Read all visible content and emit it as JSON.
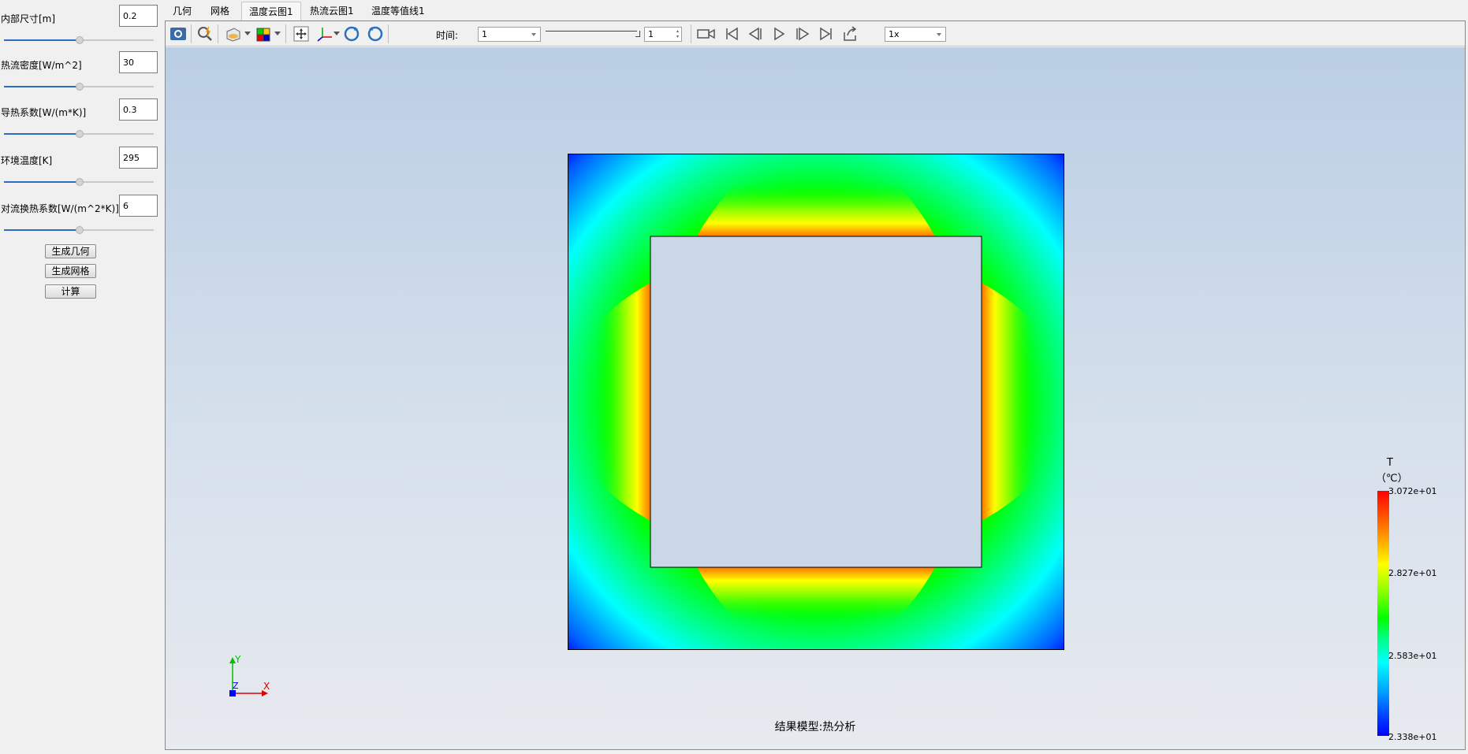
{
  "left_panel": {
    "params": [
      {
        "label": "内部尺寸[m]",
        "value": "0.2"
      },
      {
        "label": "热流密度[W/m^2]",
        "value": "30"
      },
      {
        "label": "导热系数[W/(m*K)]",
        "value": "0.3"
      },
      {
        "label": "环境温度[K]",
        "value": "295"
      },
      {
        "label": "对流换热系数[W/(m^2*K)]",
        "value": "6"
      }
    ],
    "buttons": {
      "gen_geometry": "生成几何",
      "gen_mesh": "生成网格",
      "compute": "计算"
    }
  },
  "tabs": [
    {
      "label": "几何",
      "active": false
    },
    {
      "label": "网格",
      "active": false
    },
    {
      "label": "温度云图1",
      "active": true
    },
    {
      "label": "热流云图1",
      "active": false
    },
    {
      "label": "温度等值线1",
      "active": false
    }
  ],
  "toolbar": {
    "time_label": "时间:",
    "time_combo_value": "1",
    "time_spin_value": "1",
    "speed_value": "1x",
    "icons": [
      "screenshot-icon",
      "zoom-fit-icon",
      "display-mode-icon",
      "color-map-icon",
      "pan-icon",
      "axes-orientation-icon",
      "rotate-cw-icon",
      "rotate-ccw-icon",
      "record-video-icon",
      "first-frame-icon",
      "previous-frame-icon",
      "play-icon",
      "next-frame-icon",
      "last-frame-icon",
      "export-icon"
    ]
  },
  "viewport": {
    "result_label": "结果模型:热分析",
    "axes": {
      "x": "X",
      "y": "Y",
      "z": "Z"
    }
  },
  "legend": {
    "title": "T",
    "unit": "（℃）",
    "ticks": [
      "3.072e+01",
      "2.827e+01",
      "2.583e+01",
      "2.338e+01"
    ]
  },
  "colors": {
    "hot": "#ff0000",
    "mid": "#00ff00",
    "cold": "#0000ff",
    "accent": "#2a6fc0"
  }
}
